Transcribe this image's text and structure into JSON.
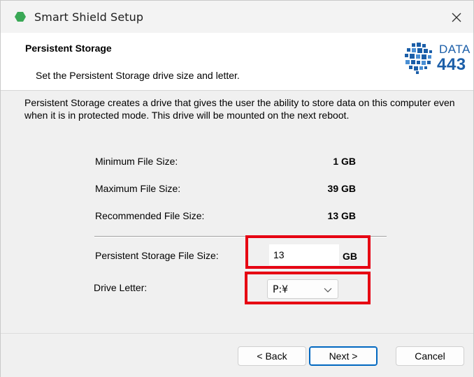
{
  "window": {
    "title": "Smart Shield Setup"
  },
  "header": {
    "title": "Persistent Storage",
    "subtitle": "Set the Persistent Storage drive size and letter.",
    "logo": {
      "line1": "DATA",
      "line2": "443",
      "icon": "data443-dots-logo"
    }
  },
  "description": "Persistent Storage creates a drive that gives the user the ability to store data on this computer even when it is in protected mode. This drive will be mounted on the next reboot.",
  "sizes": [
    {
      "label": "Minimum File Size:",
      "value": "1 GB"
    },
    {
      "label": "Maximum File Size:",
      "value": "39 GB"
    },
    {
      "label": "Recommended File Size:",
      "value": "13 GB"
    }
  ],
  "file_size": {
    "label": "Persistent Storage File Size:",
    "value": "13",
    "unit": "GB"
  },
  "drive_letter": {
    "label": "Drive Letter:",
    "value": "P:¥"
  },
  "buttons": {
    "back": "< Back",
    "next": "Next >",
    "cancel": "Cancel"
  },
  "colors": {
    "accent": "#0067c0",
    "highlight": "#e60012",
    "app_icon": "#3aa856",
    "logo": "#1b5ea8"
  }
}
